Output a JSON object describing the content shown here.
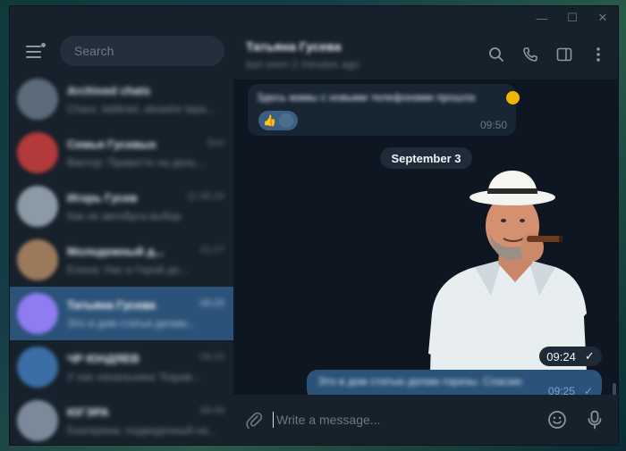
{
  "window": {
    "minimize_glyph": "—",
    "maximize_glyph": "☐",
    "close_glyph": "✕"
  },
  "sidebar": {
    "search_placeholder": "Search",
    "chats": [
      {
        "name": "Archived chats",
        "time": "",
        "preview": "Chaur, tabliniel, atnashe tapa...",
        "avatar_color": "#5b6b7a",
        "active": false
      },
      {
        "name": "Семья Гусевых",
        "time": "Sun",
        "preview": "Виктор: Приветтe на день...",
        "avatar_color": "#b23a3a",
        "active": false
      },
      {
        "name": "Игорь Гусев",
        "time": "11.08.24",
        "preview": "Как не автобуса выбор",
        "avatar_color": "#8b9aa5",
        "active": false
      },
      {
        "name": "Молодежный д...",
        "time": "21:17",
        "preview": "Елена: Нас в Герой до...",
        "avatar_color": "#9a7a5b",
        "active": false
      },
      {
        "name": "Татьяна Гусева",
        "time": "09:25",
        "preview": "Это в дом статья делаю...",
        "avatar_color": "#8e7cf0",
        "active": true
      },
      {
        "name": "ЧР ЮНДЯЕВ",
        "time": "09:15",
        "preview": "У нас начальника \"Карав...",
        "avatar_color": "#3a6ea5",
        "active": false
      },
      {
        "name": "ЮГЭРА",
        "time": "08:49",
        "preview": "Екатерина: подвиденный на...",
        "avatar_color": "#7a8a9a",
        "active": false
      }
    ]
  },
  "header": {
    "name": "Татьяна Гусева",
    "status": "last seen 2 minutes ago"
  },
  "messages": {
    "incoming_text": "Здесь мамы с новыми телефонами прошла",
    "incoming_time": "09:50",
    "reaction": "👍",
    "date_separator": "September 3",
    "sticker_time": "09:24",
    "outgoing_text": "Это в дом статью делаю горизы. Спасаю",
    "outgoing_time": "09:25",
    "check_glyph": "✓"
  },
  "composer": {
    "placeholder": "Write a message..."
  },
  "colors": {
    "accent": "#2b5278",
    "background": "#0e1621",
    "sidebar": "#17212b"
  }
}
